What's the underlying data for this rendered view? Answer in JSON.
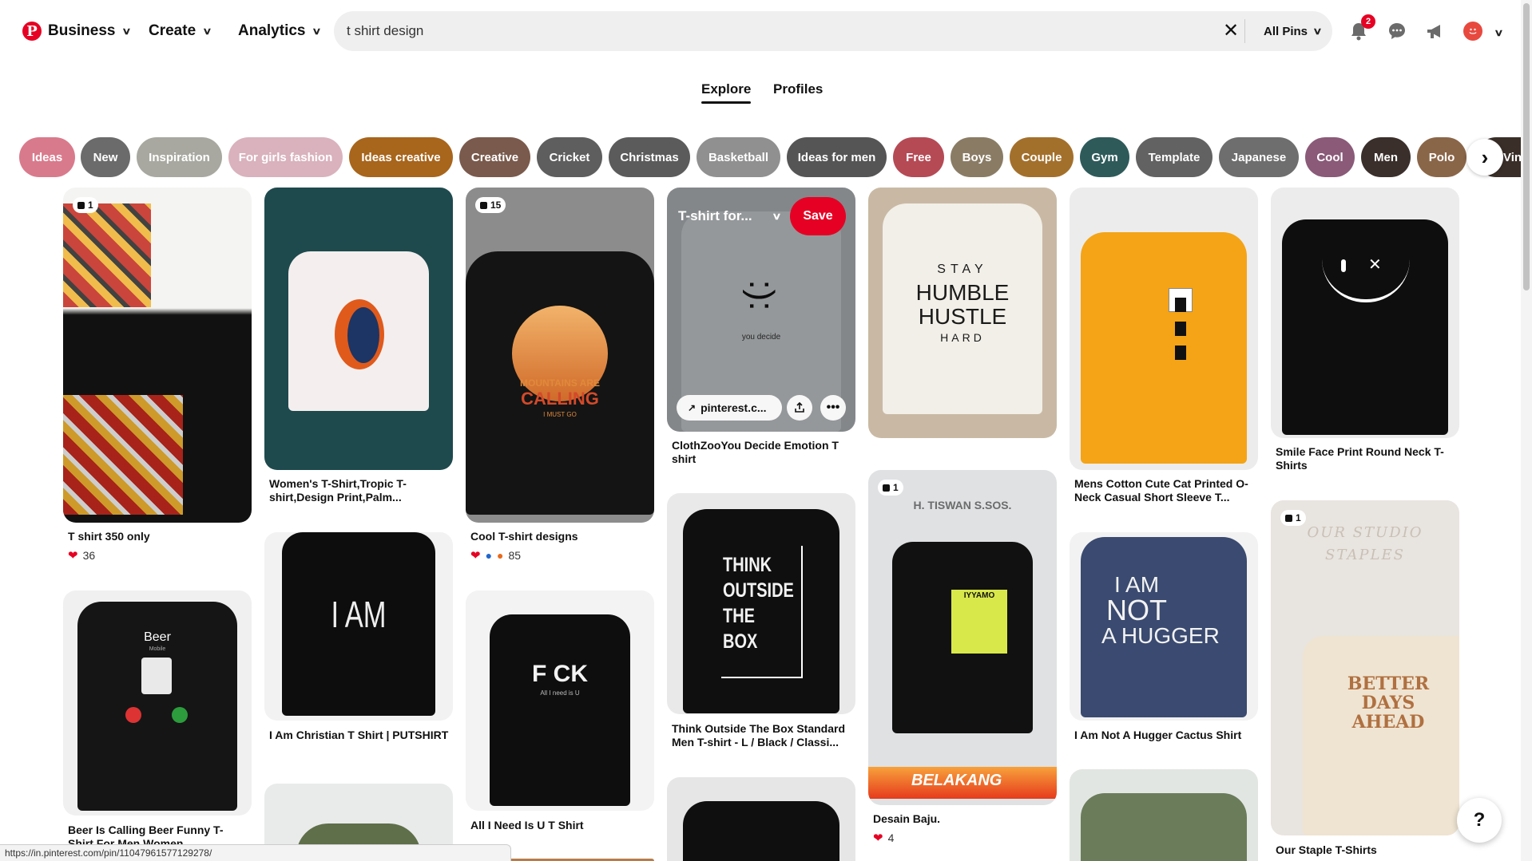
{
  "header": {
    "nav": [
      "Business",
      "Create",
      "Analytics"
    ],
    "search_value": "t shirt design",
    "filter_label": "All Pins",
    "notification_count": "2"
  },
  "tabs": [
    "Explore",
    "Profiles"
  ],
  "chips": [
    {
      "label": "Ideas",
      "color": "#d97a8c"
    },
    {
      "label": "New",
      "color": "#6b6b6b"
    },
    {
      "label": "Inspiration",
      "color": "#a8a8a0"
    },
    {
      "label": "For girls fashion",
      "color": "#d9b2bd"
    },
    {
      "label": "Ideas creative",
      "color": "#a8651c"
    },
    {
      "label": "Creative",
      "color": "#7a5a4c"
    },
    {
      "label": "Cricket",
      "color": "#5e5e5e"
    },
    {
      "label": "Christmas",
      "color": "#5b5b5b"
    },
    {
      "label": "Basketball",
      "color": "#909090"
    },
    {
      "label": "Ideas for men",
      "color": "#555"
    },
    {
      "label": "Free",
      "color": "#b54a55"
    },
    {
      "label": "Boys",
      "color": "#8a7c64"
    },
    {
      "label": "Couple",
      "color": "#a3702c"
    },
    {
      "label": "Gym",
      "color": "#2e5a5a"
    },
    {
      "label": "Template",
      "color": "#626262"
    },
    {
      "label": "Japanese",
      "color": "#6e6e6e"
    },
    {
      "label": "Cool",
      "color": "#8a5a78"
    },
    {
      "label": "Men",
      "color": "#3a2f2b"
    },
    {
      "label": "Polo",
      "color": "#8a6648"
    },
    {
      "label": "Vintage",
      "color": "#3a2f28"
    }
  ],
  "pins": {
    "p1": {
      "badge": "1",
      "title": "T shirt 350 only",
      "reactions": "36"
    },
    "p2": {
      "title": "Women's T-Shirt,Tropic T-shirt,Design Print,Palm..."
    },
    "p3": {
      "badge": "15",
      "title": "Cool T-shirt designs",
      "reactions": "85",
      "shirt": [
        "MOUNTAINS ARE",
        "CALLING",
        "I MUST GO"
      ]
    },
    "p4": {
      "title": "ClothZooYou Decide Emotion T shirt",
      "board": "T-shirt for...",
      "save": "Save",
      "link": "pinterest.c...",
      "shirt": [
        ":):",
        "you decide"
      ]
    },
    "p5": {
      "shirt": [
        "STAY",
        "HUMBLE",
        "HUSTLE",
        "HARD"
      ]
    },
    "p6": {
      "title": "Mens Cotton Cute Cat Printed O-Neck Casual Short Sleeve T..."
    },
    "p7": {
      "title": "Smile Face Print Round Neck T-Shirts"
    },
    "p8": {
      "title": "Beer Is Calling Beer Funny T-Shirt For Men Women",
      "shirt": [
        "Beer",
        "Mobile"
      ]
    },
    "p9": {
      "title": "I Am Christian T Shirt | PUTSHIRT",
      "shirt": "I AM"
    },
    "p10": {
      "title": "All I Need Is U T Shirt",
      "shirt": [
        "F CK",
        "All I need is U"
      ]
    },
    "p11": {
      "title": "Think Outside The Box Standard Men T-shirt - L / Black / Classi...",
      "shirt": [
        "THINK",
        "OUTSIDE",
        "THE",
        "BOX"
      ]
    },
    "p12": {
      "badge": "1",
      "title": "Desain Baju.",
      "reactions": "4",
      "shirt": [
        "H. TISWAN S.SOS.",
        "IYYAMO",
        "BELAKANG"
      ]
    },
    "p13": {
      "title": "I Am Not A Hugger Cactus Shirt",
      "shirt": [
        "I AM",
        "NOT",
        "A HUGGER"
      ]
    },
    "p14": {
      "badge": "1",
      "title": "Our Staple T-Shirts",
      "shirt": [
        "OUR STUDIO",
        "STAPLES",
        "BETTER",
        "DAYS",
        "AHEAD"
      ]
    }
  },
  "status_url": "https://in.pinterest.com/pin/11047961577129278/",
  "help_label": "?"
}
